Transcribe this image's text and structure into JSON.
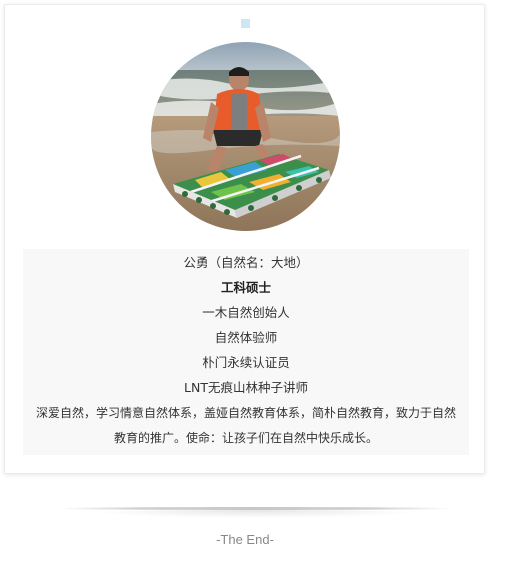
{
  "profile": {
    "name_line": "公勇（自然名：大地）",
    "degree": "工科硕士",
    "roles": [
      "一木自然创始人",
      "自然体验师",
      "朴门永续认证员",
      "LNT无痕山林种子讲师"
    ],
    "description_line1": "深爱自然，学习情意自然体系，盖娅自然教育体系，简朴自然教育，致力于自然",
    "description_line2": "教育的推广。使命：让孩子们在自然中快乐成长。"
  },
  "footer": {
    "end_text": "-The End-"
  },
  "colors": {
    "marker": "#cfe6f7",
    "bio_background": "#f8f8f8",
    "text": "#333333",
    "end_text": "#888888"
  }
}
